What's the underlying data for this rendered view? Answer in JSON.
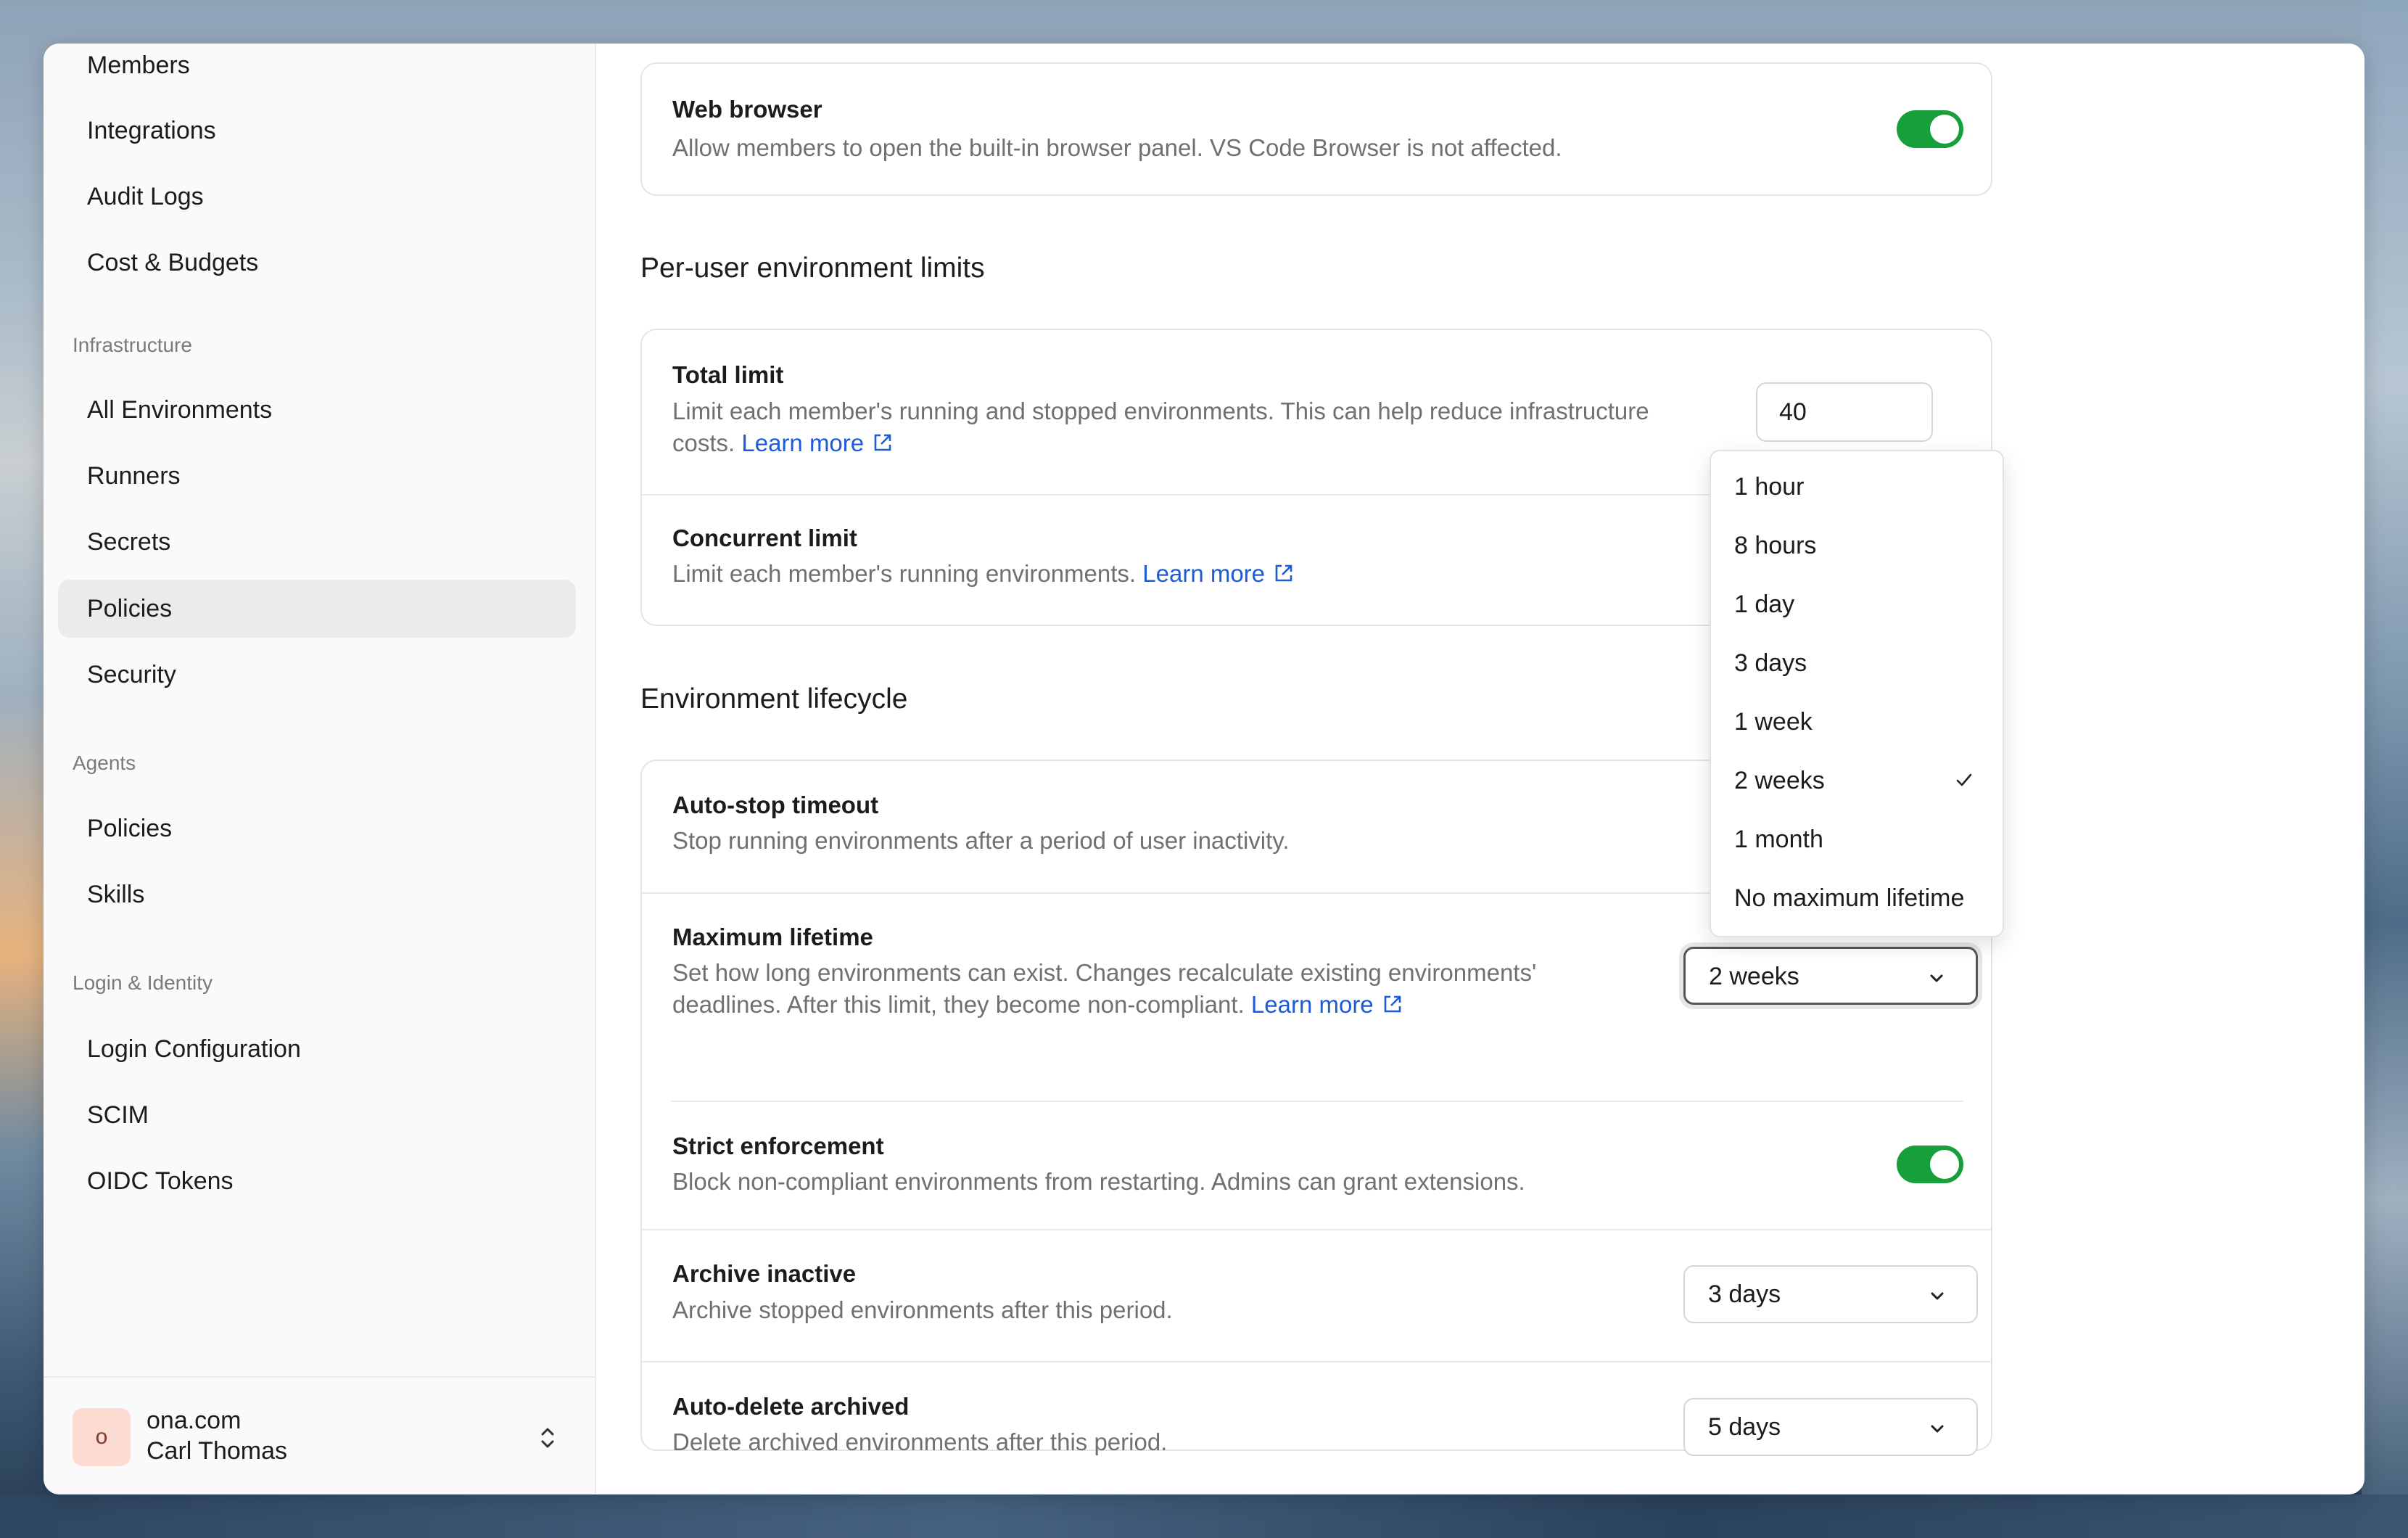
{
  "sidebar": {
    "items": [
      {
        "label": "Members"
      },
      {
        "label": "Integrations"
      },
      {
        "label": "Audit Logs"
      },
      {
        "label": "Cost & Budgets"
      },
      {
        "label": "All Environments"
      },
      {
        "label": "Runners"
      },
      {
        "label": "Secrets"
      },
      {
        "label": "Policies",
        "active": true
      },
      {
        "label": "Security"
      },
      {
        "label": "Policies"
      },
      {
        "label": "Skills"
      },
      {
        "label": "Login Configuration"
      },
      {
        "label": "SCIM"
      },
      {
        "label": "OIDC Tokens"
      }
    ],
    "groups": [
      "Infrastructure",
      "Agents",
      "Login & Identity"
    ],
    "footer": {
      "avatar_letter": "o",
      "org": "ona.com",
      "user": "Carl Thomas"
    }
  },
  "web_browser": {
    "title": "Web browser",
    "desc": "Allow members to open the built-in browser panel. VS Code Browser is not affected.",
    "enabled": true
  },
  "per_user": {
    "section_title": "Per-user environment limits",
    "total": {
      "title": "Total limit",
      "desc_line1": "Limit each member's running and stopped environments. This can help reduce infrastructure",
      "desc_line2": "costs.",
      "link": "Learn more",
      "value": "40"
    },
    "concurrent": {
      "title": "Concurrent limit",
      "desc": "Limit each member's running environments.",
      "link": "Learn more"
    }
  },
  "lifecycle": {
    "section_title": "Environment lifecycle",
    "auto_stop": {
      "title": "Auto-stop timeout",
      "desc": "Stop running environments after a period of user inactivity."
    },
    "max_lifetime": {
      "title": "Maximum lifetime",
      "desc_line1": "Set how long environments can exist. Changes recalculate existing environments'",
      "desc_line2": "deadlines. After this limit, they become non-compliant.",
      "link": "Learn more",
      "value": "2 weeks",
      "options": [
        "1 hour",
        "8 hours",
        "1 day",
        "3 days",
        "1 week",
        "2 weeks",
        "1 month",
        "No maximum lifetime"
      ],
      "selected": "2 weeks"
    },
    "strict": {
      "title": "Strict enforcement",
      "desc": "Block non-compliant environments from restarting. Admins can grant extensions.",
      "enabled": true
    },
    "archive": {
      "title": "Archive inactive",
      "desc": "Archive stopped environments after this period.",
      "value": "3 days"
    },
    "auto_delete": {
      "title": "Auto-delete archived",
      "desc": "Delete archived environments after this period.",
      "value": "5 days"
    }
  },
  "colors": {
    "accent": "#179f3c",
    "link": "#1d5bd8"
  }
}
